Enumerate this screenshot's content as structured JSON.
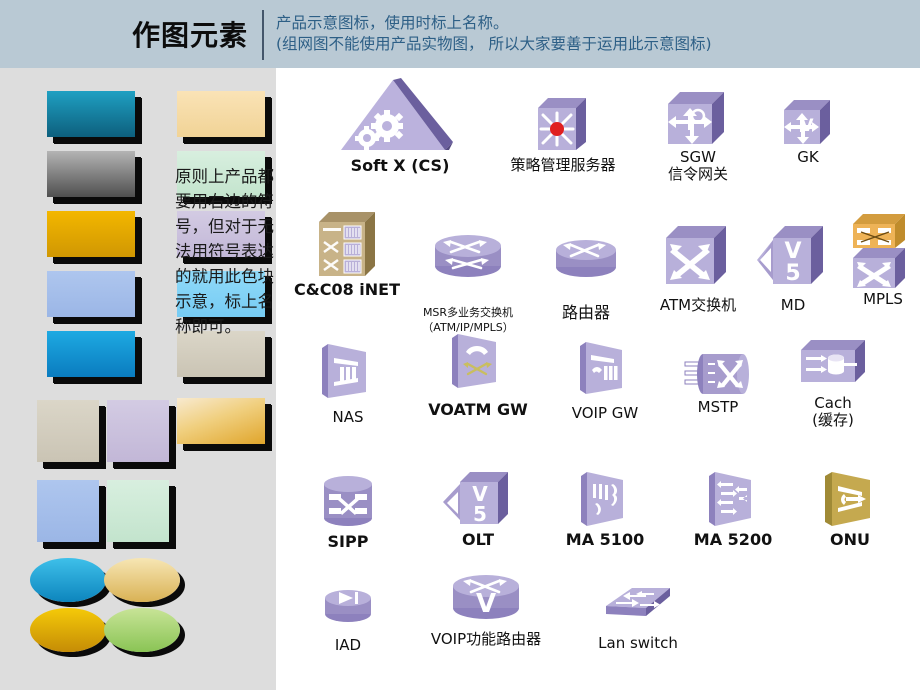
{
  "header": {
    "title": "作图元素",
    "note_line1": "产品示意图标，使用时标上名称。",
    "note_line2": "(组网图不能使用产品实物图， 所以大家要善于运用此示意图标)",
    "note_color": "#2d5f86",
    "band_color": "#b9c9d4"
  },
  "sidebar": {
    "background": "#dddddd",
    "note": "原则上产品都要用右边的符号，但对于无法用符号表达的就用此色块示意，标上名称即可。",
    "swatches": [
      {
        "name": "swatch-teal",
        "shape": "rect",
        "color_top": "#1a93b5",
        "color_bottom": "#0d5f7d"
      },
      {
        "name": "swatch-cream",
        "shape": "rect",
        "color_top": "#f8dfae",
        "color_bottom": "#f3d79e"
      },
      {
        "name": "swatch-gray",
        "shape": "rect",
        "color_top": "#a9a9a9",
        "color_bottom": "#5a5a5a"
      },
      {
        "name": "swatch-mint",
        "shape": "rect",
        "color_top": "#d3ecdb",
        "color_bottom": "#c7e6d1"
      },
      {
        "name": "swatch-gold",
        "shape": "rect",
        "color_top": "#f0b200",
        "color_bottom": "#d59b04"
      },
      {
        "name": "swatch-lavender",
        "shape": "rect",
        "color_top": "#cfc6e0",
        "color_bottom": "#c6bcd9"
      },
      {
        "name": "swatch-periwinkle",
        "shape": "rect",
        "color_top": "#a8c2ec",
        "color_bottom": "#9db9e8"
      },
      {
        "name": "swatch-skyblue",
        "shape": "rect",
        "color_top": "#8ad7f8",
        "color_bottom": "#7ccef5"
      },
      {
        "name": "swatch-blue",
        "shape": "rect",
        "color_top": "#17a3dd",
        "color_bottom": "#0d83c4"
      },
      {
        "name": "swatch-beige",
        "shape": "rect",
        "color_top": "#d7d2c3",
        "color_bottom": "#cdc8b8"
      },
      {
        "name": "swatch-beige-tall",
        "shape": "tall",
        "color_top": "#d7d2c3",
        "color_bottom": "#cdc8b8"
      },
      {
        "name": "swatch-lavender-tall",
        "shape": "tall",
        "color_top": "#cfc6e0",
        "color_bottom": "#c6bcd9"
      },
      {
        "name": "swatch-gold-gradient",
        "shape": "rect",
        "color_top": "#f6e6b4",
        "color_bottom": "#e8ac2a"
      },
      {
        "name": "swatch-periwinkle-tall",
        "shape": "tall",
        "color_top": "#a8c2ec",
        "color_bottom": "#9db9e8"
      },
      {
        "name": "swatch-mint-tall",
        "shape": "tall",
        "color_top": "#d3ecdb",
        "color_bottom": "#c7e6d1"
      },
      {
        "name": "swatch-oval-blue",
        "shape": "oval",
        "color_top": "#2fb3e4",
        "color_bottom": "#0f86bd"
      },
      {
        "name": "swatch-oval-sand",
        "shape": "oval",
        "color_top": "#f3dfa8",
        "color_bottom": "#dcb757"
      },
      {
        "name": "swatch-oval-gold",
        "shape": "oval",
        "color_top": "#f0c500",
        "color_bottom": "#c98d06"
      },
      {
        "name": "swatch-oval-green",
        "shape": "oval",
        "color_top": "#bede8a",
        "color_bottom": "#8ec659"
      }
    ]
  },
  "main": {
    "background": "#ffffff",
    "icon_fill_light": "#c9c3e3",
    "icon_fill_mid": "#a79ccd",
    "icon_fill_dark": "#6b5f9e",
    "icon_gold": "#c0a468",
    "icon_orange": "#e8a33a",
    "icons": [
      {
        "id": "soft-x-cs",
        "label_lines": [
          "Soft X (CS)"
        ],
        "bold": true,
        "size": "big"
      },
      {
        "id": "policy-server",
        "label_lines": [
          "策略管理服务器"
        ],
        "bold": false,
        "size": "norm"
      },
      {
        "id": "sgw",
        "label_lines": [
          "SGW",
          "信令网关"
        ],
        "bold": false,
        "size": "norm"
      },
      {
        "id": "gk",
        "label_lines": [
          "GK"
        ],
        "bold": false,
        "size": "norm"
      },
      {
        "id": "cc08-inet",
        "label_lines": [
          "C&C08 iNET"
        ],
        "bold": true,
        "size": "big"
      },
      {
        "id": "msr-switch",
        "label_lines": [
          "MSR多业务交换机",
          "（ATM/IP/MPLS）"
        ],
        "bold": false,
        "size": "small"
      },
      {
        "id": "router",
        "label_lines": [
          "路由器"
        ],
        "bold": false,
        "size": "big"
      },
      {
        "id": "atm-switch",
        "label_lines": [
          "ATM交换机"
        ],
        "bold": false,
        "size": "norm"
      },
      {
        "id": "md",
        "label_lines": [
          "MD"
        ],
        "bold": false,
        "size": "norm"
      },
      {
        "id": "mpls",
        "label_lines": [
          "MPLS"
        ],
        "bold": false,
        "size": "norm"
      },
      {
        "id": "nas",
        "label_lines": [
          "NAS"
        ],
        "bold": false,
        "size": "norm"
      },
      {
        "id": "voatm-gw",
        "label_lines": [
          "VOATM GW"
        ],
        "bold": true,
        "size": "big"
      },
      {
        "id": "voip-gw",
        "label_lines": [
          "VOIP GW"
        ],
        "bold": false,
        "size": "norm"
      },
      {
        "id": "mstp",
        "label_lines": [
          "MSTP"
        ],
        "bold": false,
        "size": "norm"
      },
      {
        "id": "cach",
        "label_lines": [
          "Cach",
          "(缓存)"
        ],
        "bold": false,
        "size": "norm"
      },
      {
        "id": "sipp",
        "label_lines": [
          "SIPP"
        ],
        "bold": true,
        "size": "big"
      },
      {
        "id": "olt",
        "label_lines": [
          "OLT"
        ],
        "bold": true,
        "size": "big"
      },
      {
        "id": "ma-5100",
        "label_lines": [
          "MA 5100"
        ],
        "bold": true,
        "size": "big"
      },
      {
        "id": "ma-5200",
        "label_lines": [
          "MA 5200"
        ],
        "bold": true,
        "size": "big"
      },
      {
        "id": "onu",
        "label_lines": [
          "ONU"
        ],
        "bold": true,
        "size": "big"
      },
      {
        "id": "iad",
        "label_lines": [
          "IAD"
        ],
        "bold": false,
        "size": "norm"
      },
      {
        "id": "voip-router",
        "label_lines": [
          "VOIP功能路由器"
        ],
        "bold": false,
        "size": "norm"
      },
      {
        "id": "lan-switch",
        "label_lines": [
          "Lan switch"
        ],
        "bold": false,
        "size": "norm"
      }
    ]
  }
}
